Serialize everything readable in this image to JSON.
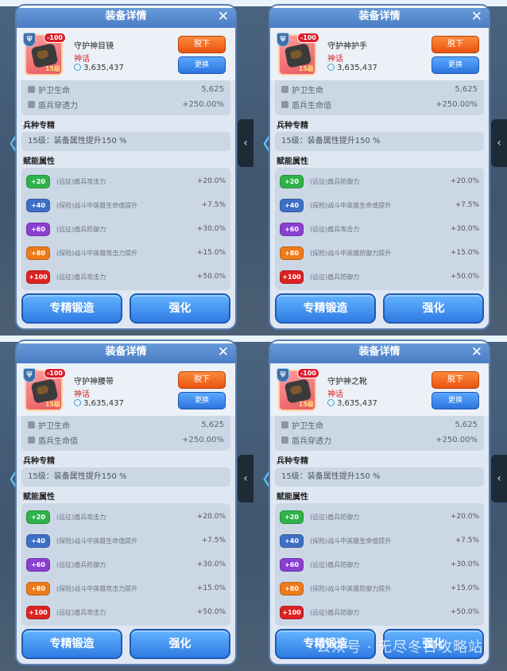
{
  "common": {
    "title": "装备详情",
    "close_glyph": "✕",
    "rarity": "神话",
    "power": "3,635,437",
    "badge": "-100",
    "level": "15级",
    "unequip": "脱下",
    "replace": "更换",
    "spec_title": "兵种专精",
    "spec_text": "15级：装备属性提升150 %",
    "attr_title": "赋能属性",
    "forge": "专精锻造",
    "enhance": "强化",
    "back_glyph": "〈",
    "side_glyph": "‹",
    "stat1_label": "护卫生命",
    "stat1_value": "5,625",
    "stat2_value": "+250.00%"
  },
  "panels": [
    {
      "name": "守护神目镜",
      "stat2_label": "盾兵穿透力",
      "attrs": [
        {
          "tag": "+20",
          "text": "(远征)盾兵攻击力",
          "value": "+20.0%"
        },
        {
          "tag": "+40",
          "text": "(探险)战斗中英雄生命值提升",
          "value": "+7.5%"
        },
        {
          "tag": "+60",
          "text": "(远征)盾兵防御力",
          "value": "+30.0%"
        },
        {
          "tag": "+80",
          "text": "(探险)战斗中英雄攻击力提升",
          "value": "+15.0%"
        },
        {
          "tag": "+100",
          "text": "(远征)盾兵攻击力",
          "value": "+50.0%"
        }
      ]
    },
    {
      "name": "守护神护手",
      "stat2_label": "盾兵生命值",
      "attrs": [
        {
          "tag": "+20",
          "text": "(远征)盾兵防御力",
          "value": "+20.0%"
        },
        {
          "tag": "+40",
          "text": "(探险)战斗中英雄生命值提升",
          "value": "+7.5%"
        },
        {
          "tag": "+60",
          "text": "(远征)盾兵攻击力",
          "value": "+30.0%"
        },
        {
          "tag": "+80",
          "text": "(探险)战斗中英雄防御力提升",
          "value": "+15.0%"
        },
        {
          "tag": "+100",
          "text": "(远征)盾兵防御力",
          "value": "+50.0%"
        }
      ]
    },
    {
      "name": "守护神腰带",
      "stat2_label": "盾兵生命值",
      "attrs": [
        {
          "tag": "+20",
          "text": "(远征)盾兵攻击力",
          "value": "+20.0%"
        },
        {
          "tag": "+40",
          "text": "(探险)战斗中英雄生命值提升",
          "value": "+7.5%"
        },
        {
          "tag": "+60",
          "text": "(远征)盾兵防御力",
          "value": "+30.0%"
        },
        {
          "tag": "+80",
          "text": "(探险)战斗中英雄攻击力提升",
          "value": "+15.0%"
        },
        {
          "tag": "+100",
          "text": "(远征)盾兵攻击力",
          "value": "+50.0%"
        }
      ]
    },
    {
      "name": "守护神之靴",
      "stat2_label": "盾兵穿透力",
      "attrs": [
        {
          "tag": "+20",
          "text": "(远征)盾兵防御力",
          "value": "+20.0%"
        },
        {
          "tag": "+40",
          "text": "(探险)战斗中英雄生命值提升",
          "value": "+7.5%"
        },
        {
          "tag": "+60",
          "text": "(远征)盾兵防御力",
          "value": "+30.0%"
        },
        {
          "tag": "+80",
          "text": "(探险)战斗中英雄防御力提升",
          "value": "+15.0%"
        },
        {
          "tag": "+100",
          "text": "(远征)盾兵防御力",
          "value": "+50.0%"
        }
      ]
    }
  ],
  "watermark": "公众号 · 无尽冬日攻略站"
}
